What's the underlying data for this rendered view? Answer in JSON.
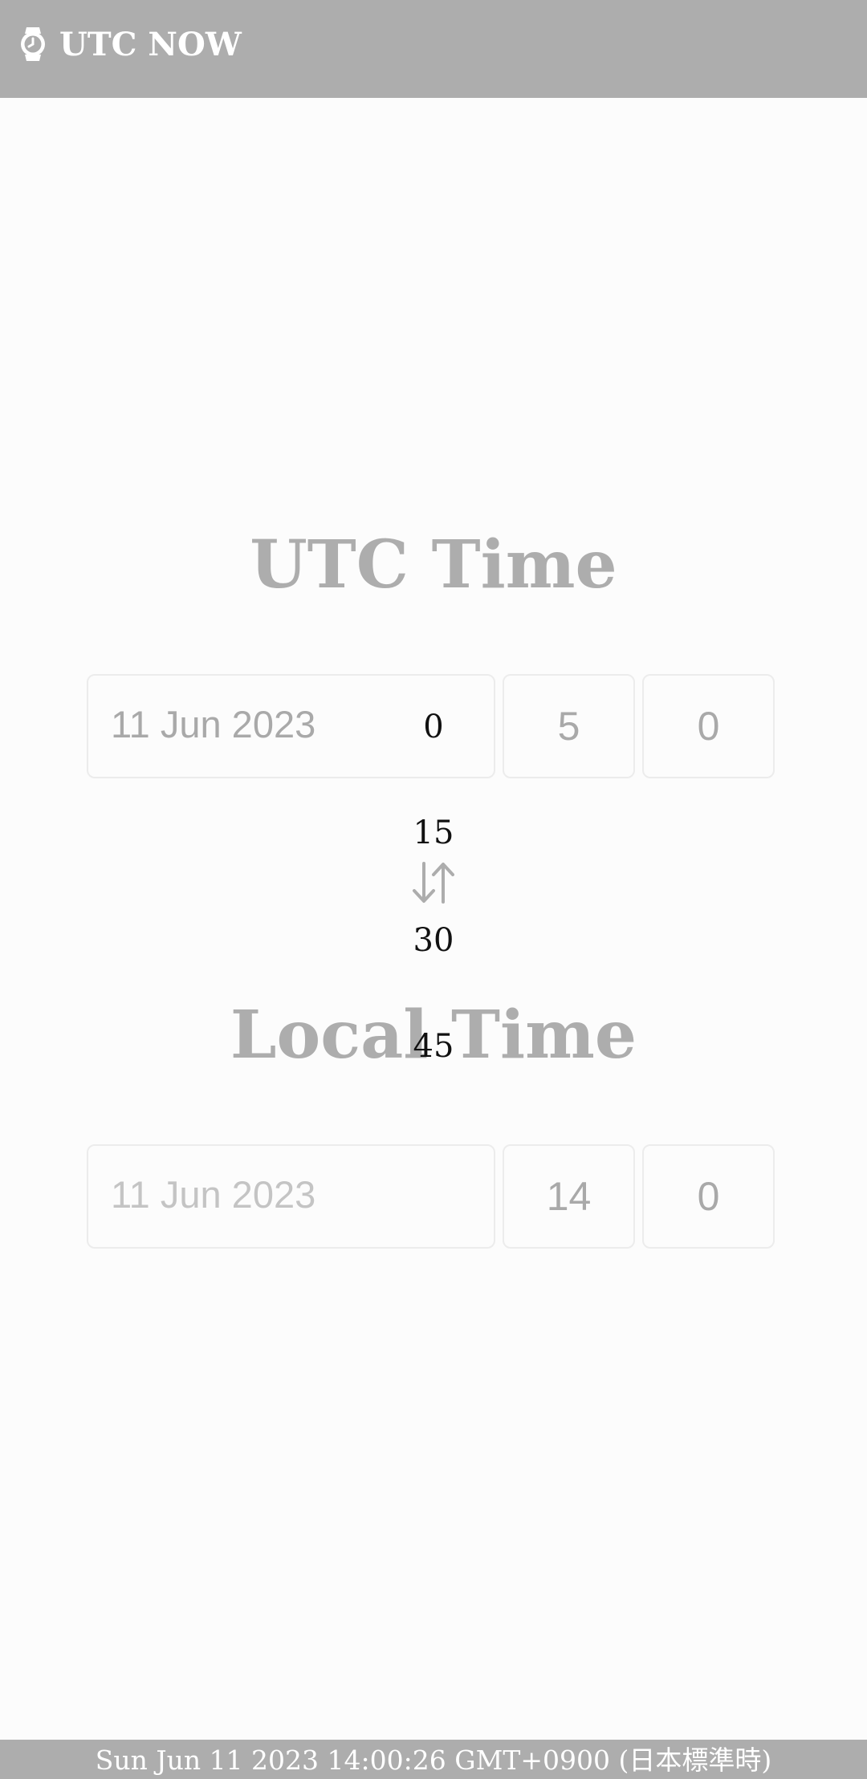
{
  "header": {
    "title": "UTC NOW",
    "icon": "watch-icon"
  },
  "utc": {
    "title": "UTC Time",
    "date": "11 Jun 2023",
    "hour": "5",
    "minute": "0"
  },
  "minute_dropdown": {
    "options": [
      "0",
      "15",
      "30",
      "45"
    ]
  },
  "swap": {
    "icon": "swap-arrows-icon"
  },
  "local": {
    "title": "Local Time",
    "date": "11 Jun 2023",
    "hour": "14",
    "minute": "0"
  },
  "footer": {
    "text": "Sun Jun 11 2023 14:00:26 GMT+0900 (日本標準時)"
  },
  "colors": {
    "header_bg": "#adadad",
    "page_bg": "#fcfcfc",
    "title_gray": "#adadad"
  }
}
